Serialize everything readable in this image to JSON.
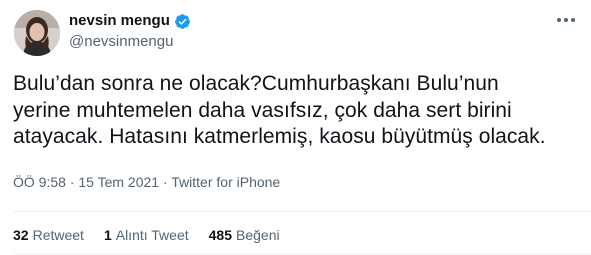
{
  "author": {
    "display_name": "nevsin mengu",
    "handle": "@nevsinmengu",
    "verified": true
  },
  "tweet": {
    "text_lines": [
      "Bulu’dan sonra ne olacak?Cumhurbaşkanı Bulu’nun",
      "yerine muhtemelen daha vasıfsız, çok daha sert birini",
      "atayacak. Hatasını katmerlemiş, kaosu büyütmüş olacak."
    ],
    "time": "ÖÖ 9:58",
    "separator": "·",
    "date": "15 Tem 2021",
    "source": "Twitter for iPhone"
  },
  "stats": {
    "retweets": {
      "count": "32",
      "label": "Retweet"
    },
    "quotes": {
      "count": "1",
      "label": "Alıntı Tweet"
    },
    "likes": {
      "count": "485",
      "label": "Beğeni"
    }
  },
  "colors": {
    "verified_badge": "#1d9bf0",
    "secondary_text": "#536471",
    "primary_text": "#0f1419"
  },
  "icons": {
    "verified": "verified-badge-icon",
    "more": "more-options-icon"
  }
}
